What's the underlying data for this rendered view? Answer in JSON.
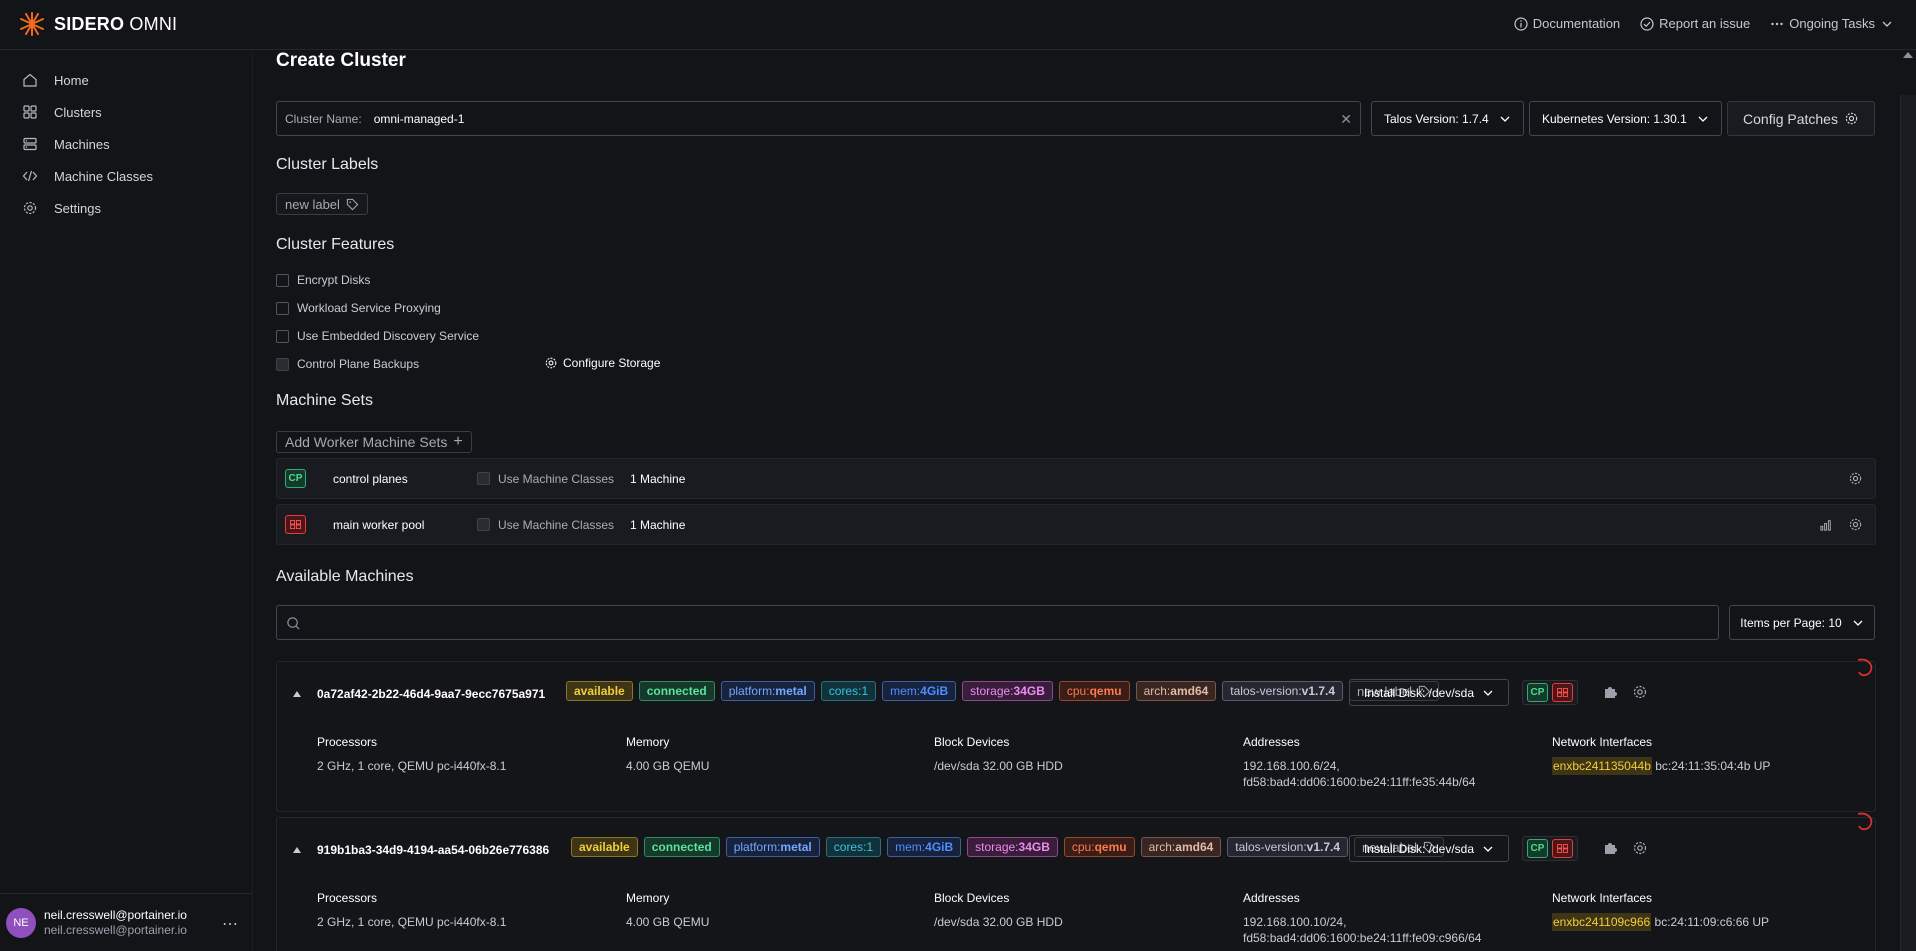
{
  "header": {
    "brand_bold": "SIDERO",
    "brand_light": " OMNI",
    "links": [
      {
        "label": "Documentation",
        "icon": "info-icon"
      },
      {
        "label": "Report an issue",
        "icon": "check-circle-icon"
      },
      {
        "label": "Ongoing Tasks",
        "icon": "ellipsis-icon"
      }
    ]
  },
  "sidebar": {
    "items": [
      {
        "label": "Home",
        "icon": "home-icon"
      },
      {
        "label": "Clusters",
        "icon": "clusters-icon"
      },
      {
        "label": "Machines",
        "icon": "server-icon"
      },
      {
        "label": "Machine Classes",
        "icon": "code-icon"
      },
      {
        "label": "Settings",
        "icon": "gear-icon"
      }
    ],
    "user": {
      "initials": "NE",
      "name": "neil.cresswell@portainer.io",
      "email": "neil.cresswell@portainer.io"
    }
  },
  "page": {
    "title": "Create Cluster",
    "cluster_name_label": "Cluster Name:",
    "cluster_name_value": "omni-managed-1",
    "talos_version": "Talos Version: 1.7.4",
    "kubernetes_version": "Kubernetes Version: 1.30.1",
    "config_patches": "Config Patches",
    "cluster_labels_title": "Cluster Labels",
    "new_label": "new label",
    "cluster_features_title": "Cluster Features",
    "features": [
      {
        "label": "Encrypt Disks",
        "checked": false
      },
      {
        "label": "Workload Service Proxying",
        "checked": false
      },
      {
        "label": "Use Embedded Discovery Service",
        "checked": false
      },
      {
        "label": "Control Plane Backups",
        "checked": false
      }
    ],
    "configure_storage": "Configure Storage",
    "machine_sets_title": "Machine Sets",
    "add_worker_sets": "Add Worker Machine Sets",
    "machine_sets": [
      {
        "role": "CP",
        "name": "control planes",
        "use_classes": "Use Machine Classes",
        "count": "1 Machine"
      },
      {
        "role": "WK",
        "name": "main worker pool",
        "use_classes": "Use Machine Classes",
        "count": "1 Machine"
      }
    ],
    "available_title": "Available Machines",
    "items_per_page": "Items per Page: 10"
  },
  "machines": [
    {
      "id": "0a72af42-2b22-46d4-9aa7-9ecc7675a971",
      "labels": {
        "available": "available",
        "connected": "connected",
        "platform_key": "platform:",
        "platform_val": "metal",
        "cores_key": "cores:",
        "cores_val": "1",
        "mem_key": "mem:",
        "mem_val": "4GiB",
        "storage_key": "storage:",
        "storage_val": "34GB",
        "cpu_key": "cpu:",
        "cpu_val": "qemu",
        "arch_key": "arch:",
        "arch_val": "amd64",
        "talos_key": "talos-version:",
        "talos_val": "v1.7.4"
      },
      "install_disk": "Install Disk: /dev/sda",
      "processors_h": "Processors",
      "processors": "2 GHz, 1 core, QEMU pc-i440fx-8.1",
      "memory_h": "Memory",
      "memory": "4.00 GB QEMU",
      "block_h": "Block Devices",
      "block": "/dev/sda 32.00 GB HDD",
      "addresses_h": "Addresses",
      "address1": "192.168.100.6/24,",
      "address2": "fd58:bad4:dd06:1600:be24:11ff:fe35:44b/64",
      "nic_h": "Network Interfaces",
      "nic_name": "enxbc241135044b",
      "nic_rest": " bc:24:11:35:04:4b UP"
    },
    {
      "id": "919b1ba3-34d9-4194-aa54-06b26e776386",
      "labels": {
        "available": "available",
        "connected": "connected",
        "platform_key": "platform:",
        "platform_val": "metal",
        "cores_key": "cores:",
        "cores_val": "1",
        "mem_key": "mem:",
        "mem_val": "4GiB",
        "storage_key": "storage:",
        "storage_val": "34GB",
        "cpu_key": "cpu:",
        "cpu_val": "qemu",
        "arch_key": "arch:",
        "arch_val": "amd64",
        "talos_key": "talos-version:",
        "talos_val": "v1.7.4"
      },
      "install_disk": "Install Disk: /dev/sda",
      "processors_h": "Processors",
      "processors": "2 GHz, 1 core, QEMU pc-i440fx-8.1",
      "memory_h": "Memory",
      "memory": "4.00 GB QEMU",
      "block_h": "Block Devices",
      "block": "/dev/sda 32.00 GB HDD",
      "addresses_h": "Addresses",
      "address1": "192.168.100.10/24,",
      "address2": "fd58:bad4:dd06:1600:be24:11ff:fe09:c966/64",
      "nic_h": "Network Interfaces",
      "nic_name": "enxbc241109c966",
      "nic_rest": " bc:24:11:09:c6:66 UP"
    }
  ],
  "colors": {
    "background": "#131418",
    "accent_orange": "#f26a21",
    "control_plane": "#4fd993",
    "worker": "#ff5050"
  }
}
